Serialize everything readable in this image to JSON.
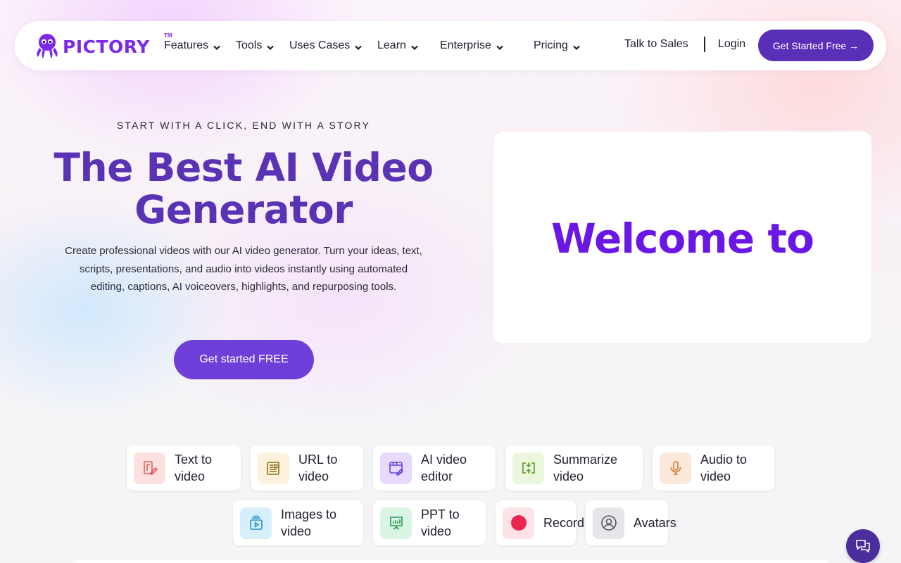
{
  "brand": {
    "name": "PICTORY",
    "trademark": "TM",
    "color": "#7d2ae8"
  },
  "nav": {
    "items": [
      {
        "label": "Features",
        "dropdown": true
      },
      {
        "label": "Tools",
        "dropdown": true
      },
      {
        "label": "Uses Cases",
        "dropdown": true
      },
      {
        "label": "Learn",
        "dropdown": true
      },
      {
        "label": "Enterprise",
        "dropdown": true
      },
      {
        "label": "Pricing",
        "dropdown": true
      }
    ],
    "talk_to_sales": "Talk to Sales",
    "login": "Login",
    "cta": "Get Started Free →"
  },
  "hero": {
    "eyebrow": "START WITH A CLICK, END WITH A STORY",
    "headline": "The Best AI Video Generator",
    "subtitle": "Create professional videos with our AI video generator. Turn your ideas, text, scripts, presentations, and audio into videos instantly using automated editing, captions, AI voiceovers, highlights, and repurposing tools.",
    "cta": "Get started FREE"
  },
  "video_preview": {
    "text": "Welcome to"
  },
  "tools": [
    {
      "label": "Text to\nvideo",
      "icon": "text-edit-icon",
      "bg": "#fde0e0",
      "color": "#e45b5b"
    },
    {
      "label": "URL to\nvideo",
      "icon": "article-icon",
      "bg": "#fdf3dc",
      "color": "#8a6a14"
    },
    {
      "label": "AI video\neditor",
      "icon": "video-edit-icon",
      "bg": "#e7d9ff",
      "color": "#6b3fd1"
    },
    {
      "label": "Summarize\nvideo",
      "icon": "compress-icon",
      "bg": "#ecf6dc",
      "color": "#5c9a2c"
    },
    {
      "label": "Audio to\nvideo",
      "icon": "microphone-icon",
      "bg": "#fde9dc",
      "color": "#d4782a"
    },
    {
      "label": "Images to\nvideo",
      "icon": "image-stack-icon",
      "bg": "#d6f0fb",
      "color": "#2b8fc4"
    },
    {
      "label": "PPT to\nvideo",
      "icon": "presentation-icon",
      "bg": "#d9f5e4",
      "color": "#2e9a5c"
    },
    {
      "label": "Record",
      "icon": "record-icon",
      "bg": "#fde3e8",
      "color": "#ec2450"
    },
    {
      "label": "Avatars",
      "icon": "avatar-icon",
      "bg": "#e6e6ea",
      "color": "#55555f"
    }
  ],
  "colors": {
    "primary": "#5a2fb8",
    "headline": "#5a33b5",
    "cta": "#6e3fd8",
    "chat": "#4a2f9c"
  }
}
